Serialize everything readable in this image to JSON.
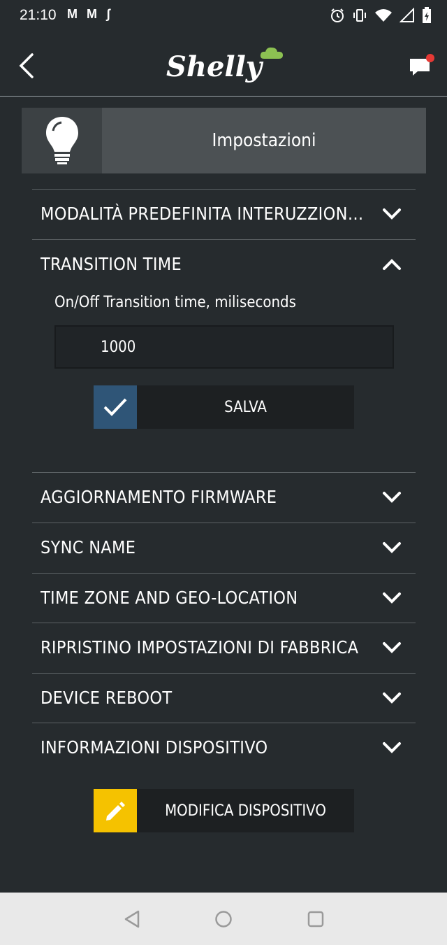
{
  "status_bar": {
    "time": "21:10",
    "notif_icons": "M M ʃ",
    "icons": [
      "alarm-icon",
      "vibrate-icon",
      "wifi-icon",
      "signal-icon",
      "battery-icon"
    ]
  },
  "header": {
    "logo_text": "Shelly",
    "back_icon": "chevron-left-icon",
    "chat_icon": "chat-notification-icon",
    "notification_dot_color": "#e53935"
  },
  "device_banner": {
    "title": "Impostazioni",
    "icon": "lightbulb-icon"
  },
  "sections": [
    {
      "label": "MODALITÀ PREDEFINITA INTERUZZIONE ...",
      "expanded": false
    },
    {
      "label": "TRANSITION TIME",
      "expanded": true
    },
    {
      "label": "AGGIORNAMENTO FIRMWARE",
      "expanded": false
    },
    {
      "label": "SYNC NAME",
      "expanded": false
    },
    {
      "label": "TIME ZONE AND GEO-LOCATION",
      "expanded": false
    },
    {
      "label": "RIPRISTINO IMPOSTAZIONI DI FABBRICA",
      "expanded": false
    },
    {
      "label": "DEVICE REBOOT",
      "expanded": false
    },
    {
      "label": "INFORMAZIONI DISPOSITIVO",
      "expanded": false
    }
  ],
  "transition": {
    "field_label": "On/Off Transition time, miliseconds",
    "value": "1000",
    "save_label": "SALVA",
    "save_icon_color": "#2f5577"
  },
  "edit_device": {
    "label": "MODIFICA DISPOSITIVO",
    "icon_color": "#f5c200"
  },
  "colors": {
    "background": "#262b2e",
    "banner": "#4c5154"
  }
}
